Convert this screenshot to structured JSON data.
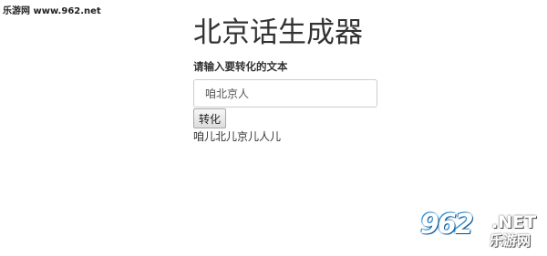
{
  "watermark": {
    "top_text": "乐游网 www.962.net",
    "logo_number": "962",
    "logo_domain": ".NET",
    "logo_name": "乐游网"
  },
  "app": {
    "title": "北京话生成器"
  },
  "form": {
    "label": "请输入要转化的文本",
    "input_value": "咱北京人",
    "convert_label": "转化"
  },
  "output": {
    "result_text": "咱儿北儿京儿人儿"
  }
}
